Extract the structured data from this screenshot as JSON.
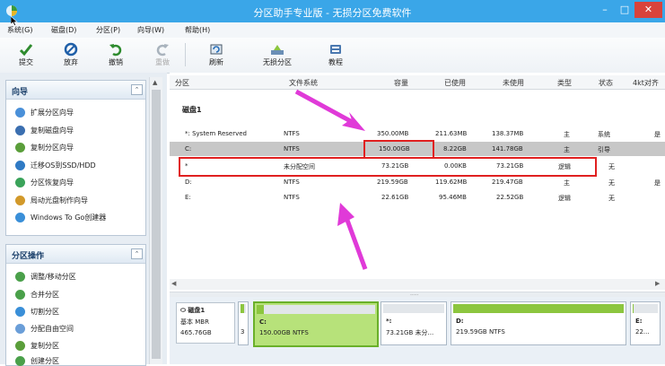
{
  "window": {
    "title": "分区助手专业版 - 无损分区免费软件",
    "controls": {
      "min": "–",
      "max": "□",
      "close": "✕"
    }
  },
  "menu": [
    "系统(G)",
    "磁盘(D)",
    "分区(P)",
    "向导(W)",
    "帮助(H)"
  ],
  "toolbar": {
    "buttons": [
      {
        "label": "提交",
        "icon": "check-icon"
      },
      {
        "label": "放弃",
        "icon": "discard-icon"
      },
      {
        "label": "撤销",
        "icon": "undo-icon"
      },
      {
        "label": "重做",
        "icon": "redo-icon",
        "disabled": true
      },
      {
        "label": "刷新",
        "icon": "refresh-icon"
      },
      {
        "label": "无损分区",
        "icon": "partition-icon"
      },
      {
        "label": "教程",
        "icon": "tutorial-icon"
      }
    ]
  },
  "wizard_panel": {
    "title": "向导",
    "items": [
      "扩展分区向导",
      "复制磁盘向导",
      "复制分区向导",
      "迁移OS到SSD/HDD",
      "分区恢复向导",
      "局动光盘制作向导",
      "Windows To Go创建器"
    ]
  },
  "ops_panel": {
    "title": "分区操作",
    "items": [
      "调整/移动分区",
      "合并分区",
      "切割分区",
      "分配自由空间",
      "复制分区",
      "创建分区"
    ]
  },
  "table": {
    "headers": [
      "分区",
      "文件系统",
      "容量",
      "已使用",
      "未使用",
      "类型",
      "状态",
      "4kt对齐"
    ],
    "disk_label": "磁盘1",
    "rows": [
      {
        "name": "*: System Reserved",
        "fs": "NTFS",
        "cap": "350.00MB",
        "used": "211.63MB",
        "free": "138.37MB",
        "type": "主",
        "status": "系统",
        "align": "是"
      },
      {
        "name": "C:",
        "fs": "NTFS",
        "cap": "150.00GB",
        "used": "8.22GB",
        "free": "141.78GB",
        "type": "主",
        "status": "引导",
        "align": ""
      },
      {
        "name": "*",
        "fs": "未分配空间",
        "cap": "73.21GB",
        "used": "0.00KB",
        "free": "73.21GB",
        "type": "逻辑",
        "status": "无",
        "align": ""
      },
      {
        "name": "D:",
        "fs": "NTFS",
        "cap": "219.59GB",
        "used": "119.62MB",
        "free": "219.47GB",
        "type": "主",
        "status": "无",
        "align": "是"
      },
      {
        "name": "E:",
        "fs": "NTFS",
        "cap": "22.61GB",
        "used": "95.46MB",
        "free": "22.52GB",
        "type": "逻辑",
        "status": "无",
        "align": ""
      }
    ]
  },
  "diskmap": {
    "disk": {
      "name": "磁盘1",
      "type": "基本 MBR",
      "size": "465.76GB"
    },
    "blocks": [
      {
        "l1": "",
        "l2": "3",
        "fill": 0.6
      },
      {
        "l1": "C:",
        "l2": "150.00GB NTFS",
        "fill": 0.06,
        "selected": true
      },
      {
        "l1": "*:",
        "l2": "73.21GB 未分...",
        "fill": 0
      },
      {
        "l1": "D:",
        "l2": "219.59GB NTFS",
        "fill": 1
      },
      {
        "l1": "E:",
        "l2": "22...",
        "fill": 0.05
      }
    ]
  },
  "colors": {
    "accent": "#3aa6e8",
    "green": "#8cc63f",
    "highlight": "#e02020",
    "arrow": "#e03ad8"
  }
}
